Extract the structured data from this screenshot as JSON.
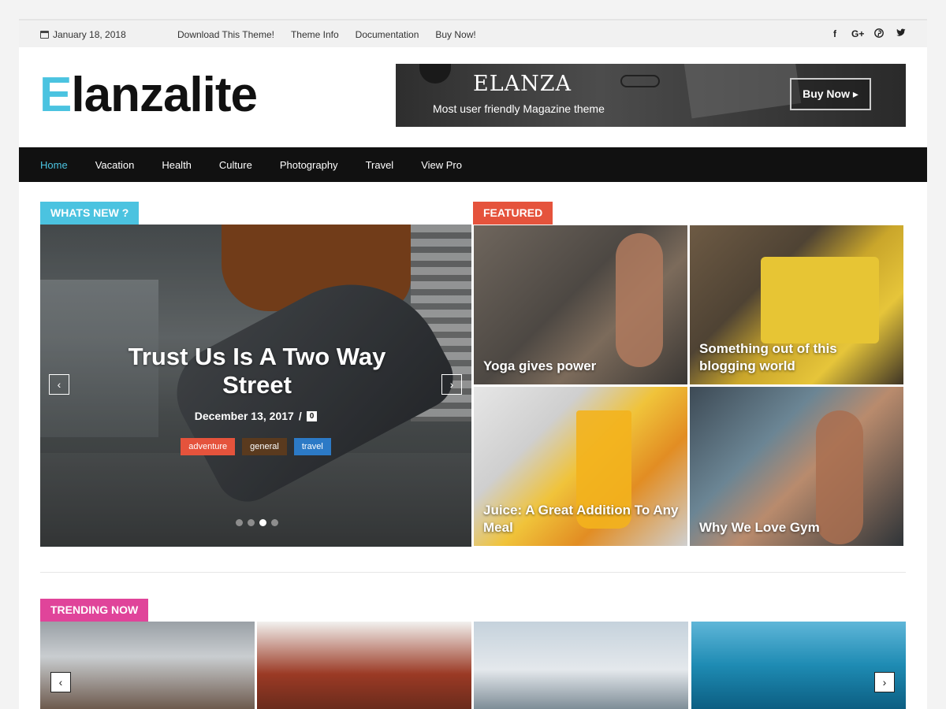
{
  "topbar": {
    "date": "January 18, 2018",
    "links": [
      "Download This Theme!",
      "Theme Info",
      "Documentation",
      "Buy Now!"
    ],
    "social": [
      {
        "name": "facebook-icon",
        "glyph": "f"
      },
      {
        "name": "google-plus-icon",
        "glyph": "G+"
      },
      {
        "name": "pinterest-icon",
        "glyph": "℗"
      },
      {
        "name": "twitter-icon",
        "glyph": "🐦"
      }
    ]
  },
  "header": {
    "logo_first": "E",
    "logo_rest": "lanzalite",
    "banner": {
      "title": "ELANZA",
      "subtitle": "Most user friendly Magazine theme",
      "button": "Buy Now ▸"
    }
  },
  "nav": {
    "items": [
      "Home",
      "Vacation",
      "Health",
      "Culture",
      "Photography",
      "Travel",
      "View Pro"
    ],
    "active_color": "#4bc3e0"
  },
  "sections": {
    "whats_new": "WHATS NEW ?",
    "featured": "FEATURED",
    "trending": "TRENDING NOW"
  },
  "slider": {
    "title": "Trust Us Is A Two Way Street",
    "date": "December 13, 2017",
    "separator": "/",
    "comments": "0",
    "tags": [
      {
        "label": "adventure",
        "color": "#e5533c"
      },
      {
        "label": "general",
        "color": "#5a3a1e"
      },
      {
        "label": "travel",
        "color": "#2c7ac6"
      }
    ],
    "prev": "‹",
    "next": "›",
    "slide_count": 4,
    "active_slide": 3
  },
  "featured": [
    {
      "title": "Yoga gives power"
    },
    {
      "title": "Something out of this blogging world"
    },
    {
      "title": "Juice: A Great Addition To Any Meal"
    },
    {
      "title": "Why We Love Gym"
    }
  ],
  "trending": {
    "prev": "‹",
    "next": "›"
  },
  "colors": {
    "accent_blue": "#4bc3e0",
    "accent_red": "#e5533c",
    "accent_pink": "#e0449a",
    "nav_bg": "#111111"
  }
}
